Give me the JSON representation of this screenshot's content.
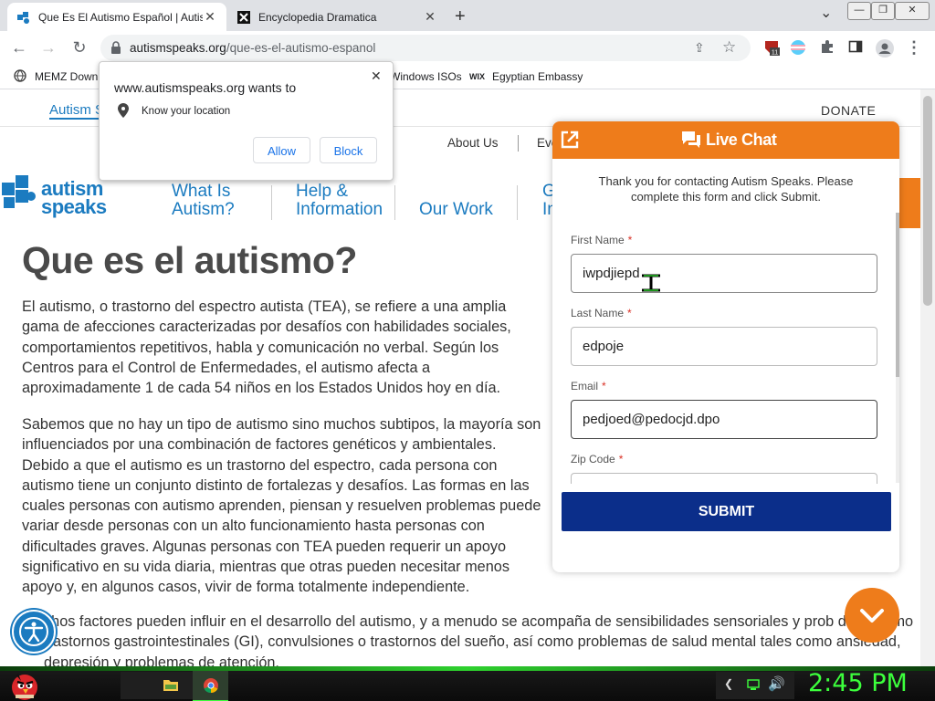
{
  "tabs": [
    {
      "title": "Que Es El Autismo Español | Autism",
      "close": "✕"
    },
    {
      "title": "Encyclopedia Dramatica",
      "close": "✕"
    }
  ],
  "new_tab": "+",
  "window_controls": {
    "dropdown": "⌄",
    "minimize": "—",
    "restore": "❐",
    "close": "✕"
  },
  "toolbar": {
    "back": "←",
    "forward": "→",
    "reload": "↻",
    "url_host": "autismspeaks.org",
    "url_path": "/que-es-el-autismo-espanol",
    "ext_badge": "11"
  },
  "bookmarks": [
    {
      "label": "MEMZ Down"
    },
    {
      "label": "Windows ISOs"
    },
    {
      "label": "Egyptian Embassy",
      "icon_text": "WIX"
    }
  ],
  "permission_popup": {
    "title": "www.autismspeaks.org wants to",
    "permission": "Know your location",
    "allow": "Allow",
    "block": "Block",
    "close": "✕"
  },
  "site": {
    "top_link": "Autism S",
    "donate": "DONATE",
    "top_nav": [
      "About Us",
      "Eve"
    ],
    "logo_line1": "autism",
    "logo_line2": "speaks",
    "nav": [
      {
        "line1": "What Is",
        "line2": "Autism?"
      },
      {
        "line1": "Help &",
        "line2": "Information"
      },
      {
        "line1": "Our Work",
        "line2": ""
      },
      {
        "line1": "G",
        "line2": "In"
      }
    ],
    "heading": "Que es el autismo?",
    "paragraphs": [
      "El autismo, o trastorno del espectro autista (TEA), se refiere a una amplia gama de afecciones caracterizadas por desafíos con habilidades sociales, comportamientos repetitivos, habla y comunicación no verbal. Según los Centros para el Control de Enfermedades, el autismo afecta a aproximadamente 1 de cada 54 niños en los Estados Unidos hoy en día.",
      "Sabemos que no hay un tipo de autismo sino muchos subtipos, la mayoría son influenciados por una combinación de factores genéticos y ambientales. Debido a que el autismo es un trastorno del espectro, cada persona con autismo tiene un conjunto distinto de fortalezas y desafíos. Las formas en las cuales personas con autismo aprenden, piensan y resuelven problemas puede variar desde personas con un alto funcionamiento hasta personas con dificultades graves. Algunas personas con TEA pueden requerir un apoyo significativo en su vida diaria, mientras que otras pueden necesitar menos apoyo y, en algunos casos, vivir de forma totalmente independiente.",
      "chos factores pueden influir en el desarrollo del autismo, y a menudo se acompaña de sensibilidades sensoriales y prob dicos como trastornos gastrointestinales (GI), convulsiones o trastornos del sueño, así como problemas de salud mental tales como ansiedad, depresión y problemas de atención."
    ]
  },
  "chat": {
    "title": "Live Chat",
    "intro": "Thank you for contacting Autism Speaks. Please complete this form and click Submit.",
    "fields": [
      {
        "label": "First Name",
        "value": "iwpdjiepd"
      },
      {
        "label": "Last Name",
        "value": "edpoje"
      },
      {
        "label": "Email",
        "value": "pedjoed@pedocjd.dpo"
      },
      {
        "label": "Zip Code",
        "value": ""
      }
    ],
    "required_mark": "*",
    "submit": "SUBMIT"
  },
  "taskbar": {
    "clock": "2:45 PM"
  },
  "colors": {
    "orange": "#ee7c1b",
    "submit_blue": "#0b2e8a",
    "link_blue": "#1b7bc0",
    "clock_green": "#3cff3c"
  }
}
